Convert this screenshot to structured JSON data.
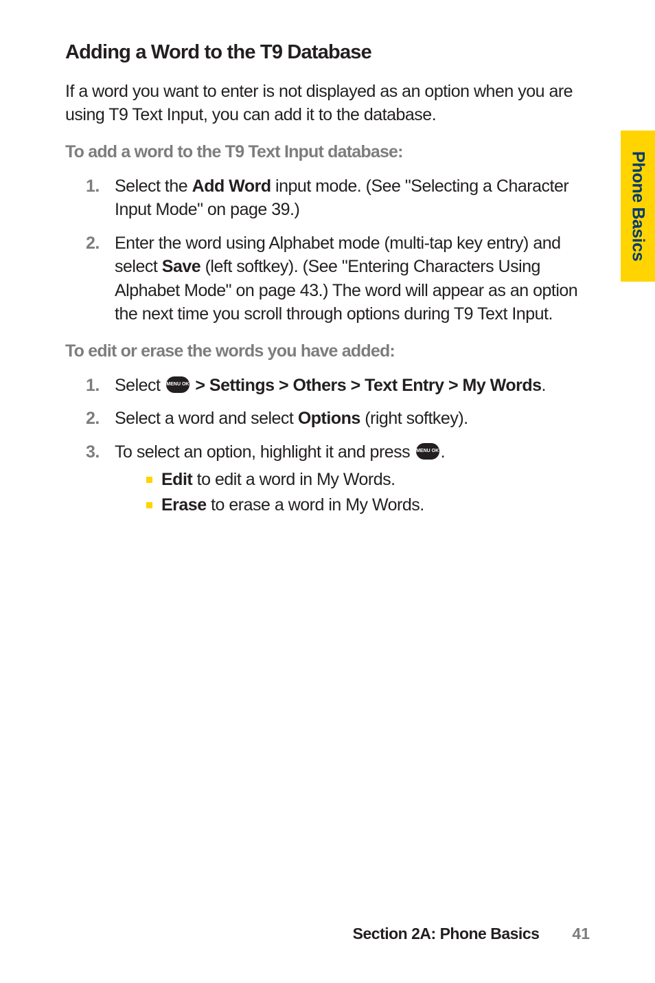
{
  "tab_label": "Phone Basics",
  "heading": "Adding a Word to the T9 Database",
  "intro": "If a word you want to enter is not displayed as an option when you are using T9 Text Input, you can add it to the database.",
  "subhead1": "To add a word to the T9 Text Input database:",
  "step1_1_pre": "Select the ",
  "step1_1_bold": "Add Word",
  "step1_1_post": " input mode. (See \"Selecting a Character Input Mode\" on page 39.)",
  "step1_2_pre": "Enter the word using Alphabet mode (multi-tap key entry) and select ",
  "step1_2_bold": "Save",
  "step1_2_post": " (left softkey). (See \"Entering Characters Using Alphabet Mode\" on page 43.) The word will appear as an option the next time you scroll through options during T9 Text Input.",
  "subhead2": "To edit or erase the words you have added:",
  "step2_1_pre": "Select ",
  "step2_1_bold": " > Settings > Others > Text Entry > My Words",
  "step2_1_post": ".",
  "step2_2_pre": "Select a word and select ",
  "step2_2_bold": "Options",
  "step2_2_post": " (right softkey).",
  "step2_3_pre": "To select an option, highlight it and press ",
  "step2_3_post": ".",
  "sub_a_bold": "Edit",
  "sub_a_post": " to edit a word in My Words.",
  "sub_b_bold": "Erase",
  "sub_b_post": " to erase a word in My Words.",
  "menu_icon_text": "MENU\nOK",
  "footer_title": "Section 2A: Phone Basics",
  "footer_page": "41",
  "num1": "1.",
  "num2": "2.",
  "num3": "3."
}
